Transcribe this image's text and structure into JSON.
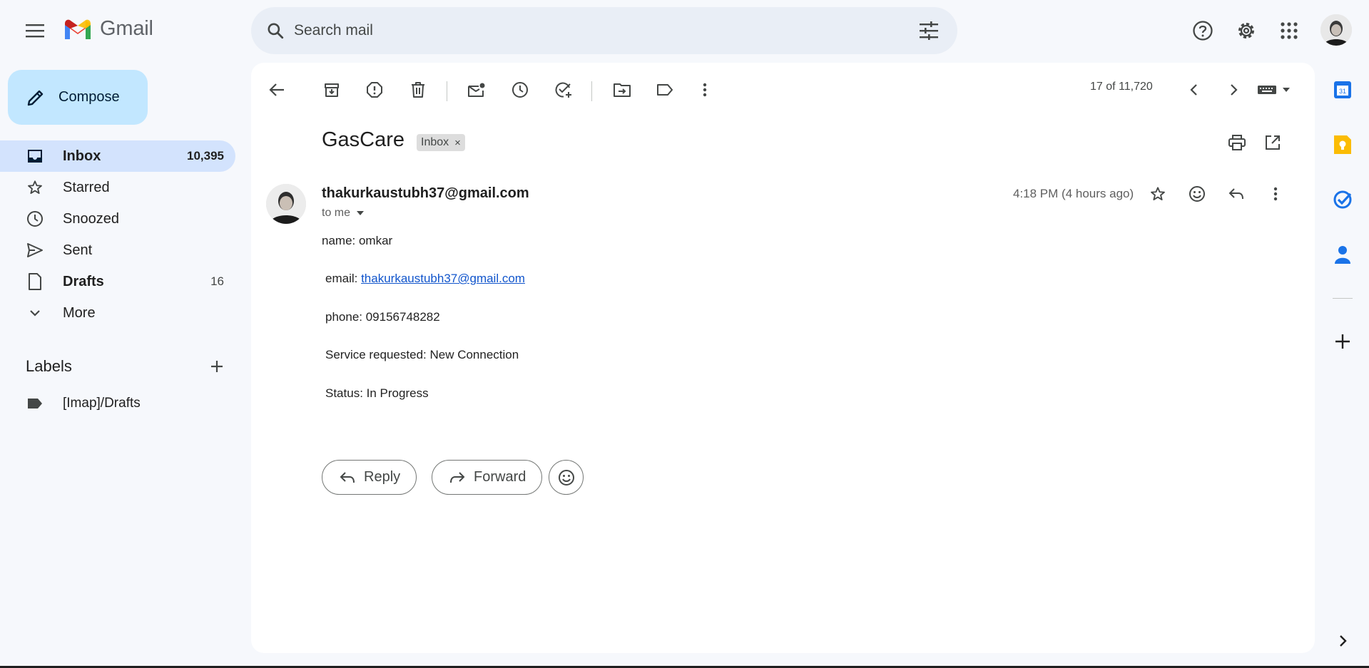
{
  "app": {
    "name": "Gmail"
  },
  "search": {
    "placeholder": "Search mail"
  },
  "compose": {
    "label": "Compose"
  },
  "nav": [
    {
      "label": "Inbox",
      "count": "10,395"
    },
    {
      "label": "Starred",
      "count": ""
    },
    {
      "label": "Snoozed",
      "count": ""
    },
    {
      "label": "Sent",
      "count": ""
    },
    {
      "label": "Drafts",
      "count": "16"
    },
    {
      "label": "More",
      "count": ""
    }
  ],
  "labels": {
    "title": "Labels",
    "items": [
      {
        "label": "[Imap]/Drafts"
      }
    ]
  },
  "toolbar": {
    "pager": "17 of 11,720"
  },
  "email": {
    "subject": "GasCare",
    "chip": "Inbox",
    "chip_close": "×",
    "sender": "thakurkaustubh37@gmail.com",
    "to": "to me",
    "time": "4:18 PM (4 hours ago)",
    "body": {
      "name": "name: omkar",
      "email_prefix": "email: ",
      "email_link": "thakurkaustubh37@gmail.com",
      "phone": "phone: 09156748282",
      "service": "Service requested: New Connection",
      "status": "Status: In Progress"
    }
  },
  "actions": {
    "reply": "Reply",
    "forward": "Forward"
  },
  "colors": {
    "accent": "#c2e7ff",
    "active_nav": "#d3e3fd",
    "search_bg": "#e9eef6",
    "link": "#1155cc",
    "background": "#f6f8fc"
  }
}
